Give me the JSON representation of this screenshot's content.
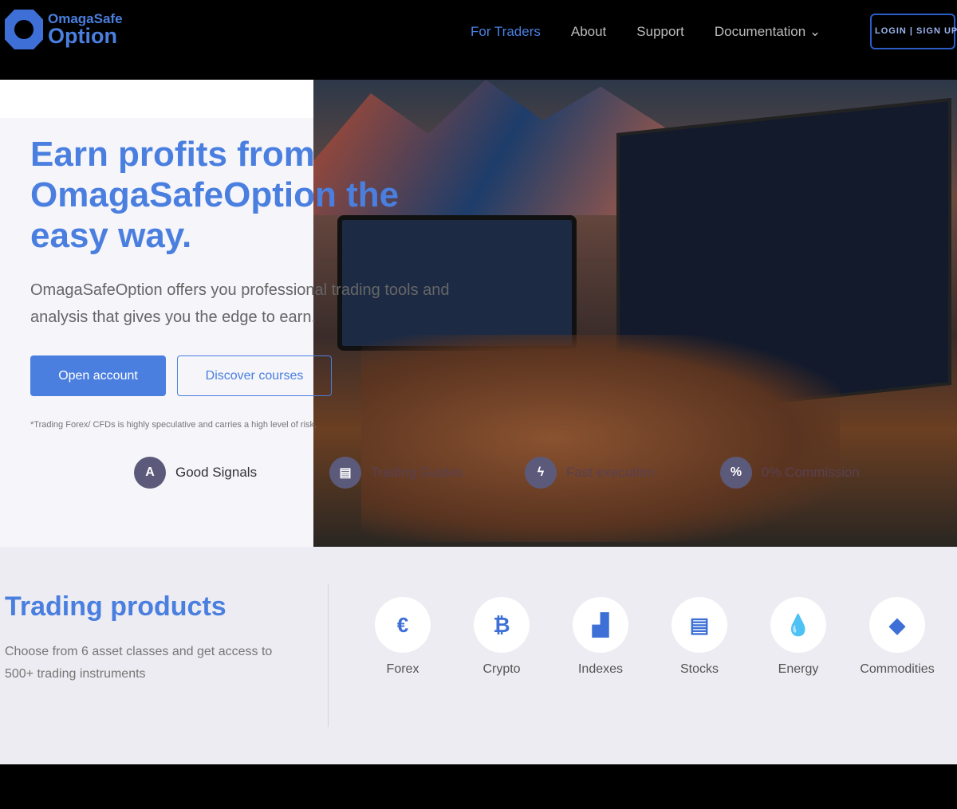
{
  "nav": {
    "logo_top": "OmagaSafe",
    "logo_bottom": "Option",
    "items": [
      "For Traders",
      "About",
      "Support",
      "Documentation"
    ],
    "login": "LOGIN | SIGN UP"
  },
  "hero": {
    "headline": "Earn profits from OmagaSafeOption the easy way.",
    "subtitle": "OmagaSafeOption offers you professional trading tools and analysis that gives you the edge to earn.",
    "primary_button": "Open account",
    "secondary_button": "Discover courses",
    "disclaimer": "*Trading Forex/ CFDs is highly speculative and carries a high level of risk.",
    "features": [
      {
        "label": "Good Signals",
        "icon": "A"
      },
      {
        "label": "Trading Guides",
        "icon": "▤"
      },
      {
        "label": "Fast execution",
        "icon": "ϟ"
      },
      {
        "label": "0% Commission",
        "icon": "%"
      }
    ]
  },
  "products": {
    "title": "Trading products",
    "description": "Choose from 6 asset classes and get access to 500+ trading instruments",
    "assets": [
      {
        "label": "Forex",
        "icon": "€"
      },
      {
        "label": "Crypto",
        "icon": "₿"
      },
      {
        "label": "Indexes",
        "icon": "▟"
      },
      {
        "label": "Stocks",
        "icon": "▤"
      },
      {
        "label": "Energy",
        "icon": "💧"
      },
      {
        "label": "Commodities",
        "icon": "◆"
      }
    ]
  },
  "colors": {
    "accent": "#4a7fe0"
  }
}
